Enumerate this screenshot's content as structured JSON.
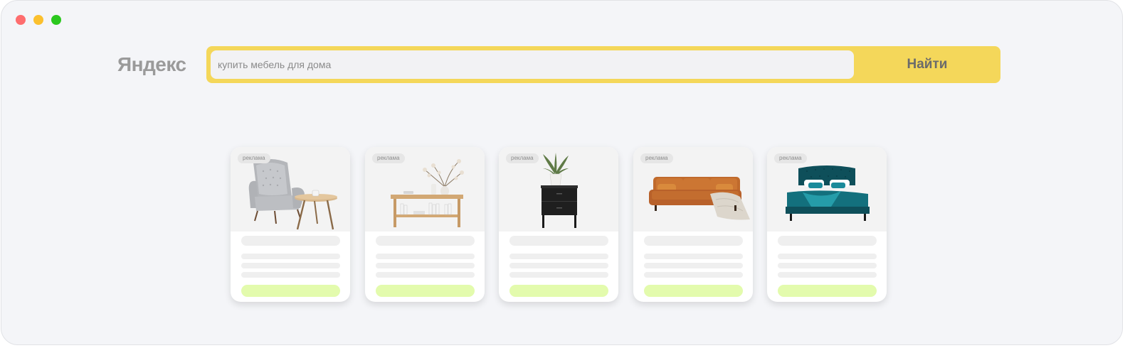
{
  "window": {
    "controls": [
      {
        "name": "close",
        "color": "#fe6d6e"
      },
      {
        "name": "minimize",
        "color": "#fbc02e"
      },
      {
        "name": "maximize",
        "color": "#2bc81e"
      }
    ]
  },
  "header": {
    "logo": "Яндекс",
    "search": {
      "value": "купить мебель для дома",
      "button_label": "Найти",
      "accent_color": "#f4d75a"
    }
  },
  "cards": [
    {
      "badge": "реклама",
      "image": "armchair-with-side-table"
    },
    {
      "badge": "реклама",
      "image": "wooden-console-with-vase"
    },
    {
      "badge": "реклама",
      "image": "black-nightstand-with-plant"
    },
    {
      "badge": "реклама",
      "image": "orange-leather-sofa"
    },
    {
      "badge": "реклама",
      "image": "teal-upholstered-bed"
    }
  ],
  "skeleton": {
    "placeholder_color": "#efefef",
    "cta_color": "#e3fbad"
  }
}
